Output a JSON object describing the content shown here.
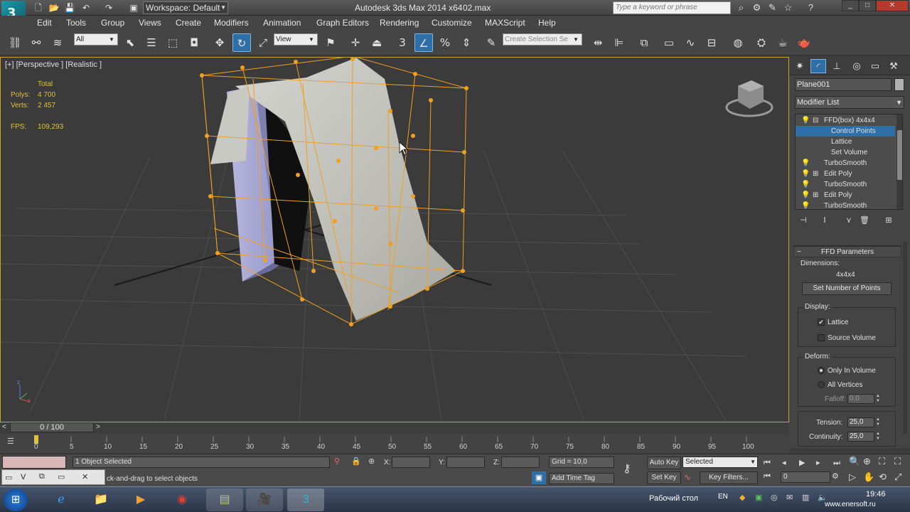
{
  "window": {
    "app_title": "Autodesk 3ds Max  2014 x64",
    "file_name": "02.max",
    "workspace_label": "Workspace: Default",
    "search_placeholder": "Type a keyword or phrase"
  },
  "menu": [
    "Edit",
    "Tools",
    "Group",
    "Views",
    "Create",
    "Modifiers",
    "Animation",
    "Graph Editors",
    "Rendering",
    "Customize",
    "MAXScript",
    "Help"
  ],
  "toolbar": {
    "filter_value": "All",
    "refcoord_value": "View",
    "snap_value": "3",
    "selection_set_placeholder": "Create Selection Se"
  },
  "viewport": {
    "label": "[+] [Perspective ] [Realistic ]",
    "stats_header": "Total",
    "polys_label": "Polys:",
    "polys_value": "4 700",
    "verts_label": "Verts:",
    "verts_value": "2 457",
    "fps_label": "FPS:",
    "fps_value": "109,293",
    "axis_z": "z",
    "axis_x": "x"
  },
  "command_panel": {
    "object_name": "Plane001",
    "modifier_list": "Modifier List",
    "stack": [
      {
        "label": "FFD(box) 4x4x4",
        "type": "modifier"
      },
      {
        "label": "Control Points",
        "type": "sub",
        "selected": true
      },
      {
        "label": "Lattice",
        "type": "sub"
      },
      {
        "label": "Set Volume",
        "type": "sub"
      },
      {
        "label": "TurboSmooth",
        "type": "modifier"
      },
      {
        "label": "Edit Poly",
        "type": "modifier"
      },
      {
        "label": "TurboSmooth",
        "type": "modifier"
      },
      {
        "label": "Edit Poly",
        "type": "modifier"
      },
      {
        "label": "TurboSmooth",
        "type": "modifier"
      }
    ],
    "rollout_title": "FFD Parameters",
    "dimensions_label": "Dimensions:",
    "dimensions_value": "4x4x4",
    "set_points_button": "Set Number of Points",
    "display_label": "Display:",
    "lattice_label": "Lattice",
    "lattice_checked": true,
    "source_volume_label": "Source Volume",
    "source_volume_checked": false,
    "deform_label": "Deform:",
    "only_in_volume_label": "Only In Volume",
    "all_vertices_label": "All Vertices",
    "deform_mode": "Only In Volume",
    "falloff_label": "Falloff:",
    "falloff_value": "0,0",
    "tension_label": "Tension:",
    "tension_value": "25,0",
    "continuity_label": "Continuity:",
    "continuity_value": "25,0"
  },
  "timeline": {
    "frame_counter": "0 / 100",
    "ticks": [
      "0",
      "5",
      "10",
      "15",
      "20",
      "25",
      "30",
      "35",
      "40",
      "45",
      "50",
      "55",
      "60",
      "65",
      "70",
      "75",
      "80",
      "85",
      "90",
      "95",
      "100"
    ]
  },
  "status": {
    "selection_text": "1 Object Selected",
    "prompt_text": "ck-and-drag to select objects",
    "x_label": "X:",
    "y_label": "Y:",
    "z_label": "Z:",
    "grid_text": "Grid = 10,0",
    "add_time_tag": "Add Time Tag",
    "auto_key": "Auto Key",
    "set_key": "Set Key",
    "key_mode": "Selected",
    "key_filters": "Key Filters...",
    "current_frame": "0",
    "mini_listener": "V"
  },
  "taskbar": {
    "desktop_label": "Рабочий стол",
    "language": "EN",
    "clock": "19:46",
    "watermark": "www.enersoft.ru"
  },
  "colors": {
    "selection_accent": "#2f6fa8",
    "viewport_border": "#c9a02c",
    "lattice": "#f0a020",
    "stats_text": "#e0c040"
  }
}
